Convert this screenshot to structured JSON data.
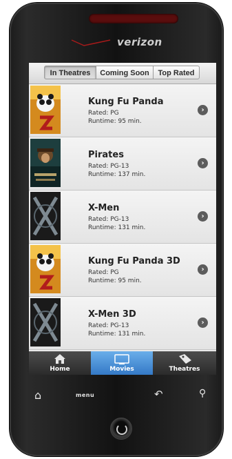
{
  "device": {
    "brand": "verizon"
  },
  "tabs": [
    {
      "label": "In Theatres",
      "active": true
    },
    {
      "label": "Coming Soon",
      "active": false
    },
    {
      "label": "Top Rated",
      "active": false
    }
  ],
  "movies": [
    {
      "title": "Kung Fu Panda",
      "rated": "Rated: PG",
      "runtime": "Runtime: 95 min.",
      "poster_icon": "kung-fu-panda-poster"
    },
    {
      "title": "Pirates",
      "rated": "Rated: PG-13",
      "runtime": "Runtime: 137 min.",
      "poster_icon": "pirates-poster"
    },
    {
      "title": "X-Men",
      "rated": "Rated: PG-13",
      "runtime": "Runtime: 131 min.",
      "poster_icon": "x-men-poster"
    },
    {
      "title": "Kung Fu Panda 3D",
      "rated": "Rated: PG",
      "runtime": "Runtime: 95 min.",
      "poster_icon": "kung-fu-panda-poster"
    },
    {
      "title": "X-Men 3D",
      "rated": "Rated: PG-13",
      "runtime": "Runtime: 131 min.",
      "poster_icon": "x-men-poster"
    }
  ],
  "bottom_nav": {
    "home": "Home",
    "movies": "Movies",
    "theatres": "Theatres",
    "active": "movies"
  },
  "hardware_keys": {
    "menu": "menu"
  },
  "colors": {
    "active_tab_blue": "#3479c6",
    "chevron": "#5c5c5c"
  }
}
